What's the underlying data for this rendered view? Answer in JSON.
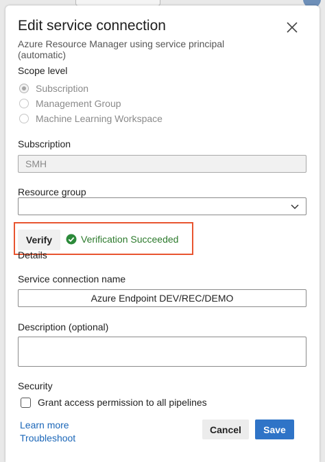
{
  "dialog": {
    "title": "Edit service connection",
    "subtitle": "Azure Resource Manager using service principal (automatic)",
    "close_icon": "close-icon"
  },
  "scope": {
    "label": "Scope level",
    "options": [
      {
        "label": "Subscription",
        "selected": true
      },
      {
        "label": "Management Group",
        "selected": false
      },
      {
        "label": "Machine Learning Workspace",
        "selected": false
      }
    ]
  },
  "subscription": {
    "label": "Subscription",
    "value": "SMH"
  },
  "resource_group": {
    "label": "Resource group",
    "value": "",
    "dropdown_icon": "chevron-down-icon"
  },
  "verify": {
    "button_label": "Verify",
    "status_text": "Verification Succeeded",
    "status_icon": "check-circle-icon",
    "status_color": "#2c7a2c",
    "highlight_color": "#e8542f"
  },
  "details": {
    "heading": "Details",
    "connection_name_label": "Service connection name",
    "connection_name_value": "Azure Endpoint DEV/REC/DEMO",
    "description_label": "Description (optional)",
    "description_value": ""
  },
  "security": {
    "label": "Security",
    "checkbox_label": "Grant access permission to all pipelines",
    "checked": false
  },
  "footer": {
    "learn_more": "Learn more",
    "troubleshoot": "Troubleshoot",
    "cancel_label": "Cancel",
    "save_label": "Save",
    "primary_color": "#2f74c7"
  }
}
